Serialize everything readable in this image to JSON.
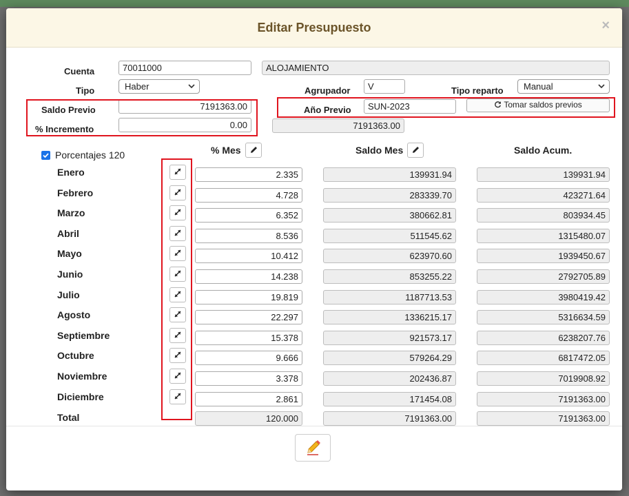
{
  "modal": {
    "title": "Editar Presupuesto",
    "close_symbol": "×"
  },
  "form": {
    "cuenta": {
      "label": "Cuenta",
      "value": "70011000",
      "description": "ALOJAMIENTO"
    },
    "tipo": {
      "label": "Tipo",
      "selected": "Haber"
    },
    "agrupador": {
      "label": "Agrupador",
      "value": "V"
    },
    "tipo_reparto": {
      "label": "Tipo reparto",
      "selected": "Manual"
    },
    "saldo_previo": {
      "label": "Saldo Previo",
      "value": "7191363.00"
    },
    "ano_previo": {
      "label": "Año Previo",
      "value": "SUN-2023",
      "computed": "7191363.00"
    },
    "tomar_saldos": {
      "label": "Tomar saldos previos",
      "icon": "refresh-icon"
    },
    "incremento": {
      "label": "% Incremento",
      "value": "0.00"
    },
    "porcentajes": {
      "label": "Porcentajes 120",
      "checked": true
    }
  },
  "table": {
    "headers": {
      "pct_mes": "% Mes",
      "saldo_mes": "Saldo Mes",
      "saldo_acum": "Saldo Acum."
    },
    "rows": [
      {
        "month": "Enero",
        "pct": "2.335",
        "saldo": "139931.94",
        "acum": "139931.94"
      },
      {
        "month": "Febrero",
        "pct": "4.728",
        "saldo": "283339.70",
        "acum": "423271.64"
      },
      {
        "month": "Marzo",
        "pct": "6.352",
        "saldo": "380662.81",
        "acum": "803934.45"
      },
      {
        "month": "Abril",
        "pct": "8.536",
        "saldo": "511545.62",
        "acum": "1315480.07"
      },
      {
        "month": "Mayo",
        "pct": "10.412",
        "saldo": "623970.60",
        "acum": "1939450.67"
      },
      {
        "month": "Junio",
        "pct": "14.238",
        "saldo": "853255.22",
        "acum": "2792705.89"
      },
      {
        "month": "Julio",
        "pct": "19.819",
        "saldo": "1187713.53",
        "acum": "3980419.42"
      },
      {
        "month": "Agosto",
        "pct": "22.297",
        "saldo": "1336215.17",
        "acum": "5316634.59"
      },
      {
        "month": "Septiembre",
        "pct": "15.378",
        "saldo": "921573.17",
        "acum": "6238207.76"
      },
      {
        "month": "Octubre",
        "pct": "9.666",
        "saldo": "579264.29",
        "acum": "6817472.05"
      },
      {
        "month": "Noviembre",
        "pct": "3.378",
        "saldo": "202436.87",
        "acum": "7019908.92"
      },
      {
        "month": "Diciembre",
        "pct": "2.861",
        "saldo": "171454.08",
        "acum": "7191363.00"
      }
    ],
    "total": {
      "label": "Total",
      "pct": "120.000",
      "saldo": "7191363.00",
      "acum": "7191363.00"
    }
  },
  "colors": {
    "highlight_border": "#e0141e",
    "header_bg": "#fcf7e6",
    "title": "#6b5429",
    "checkbox": "#1a73e8"
  }
}
